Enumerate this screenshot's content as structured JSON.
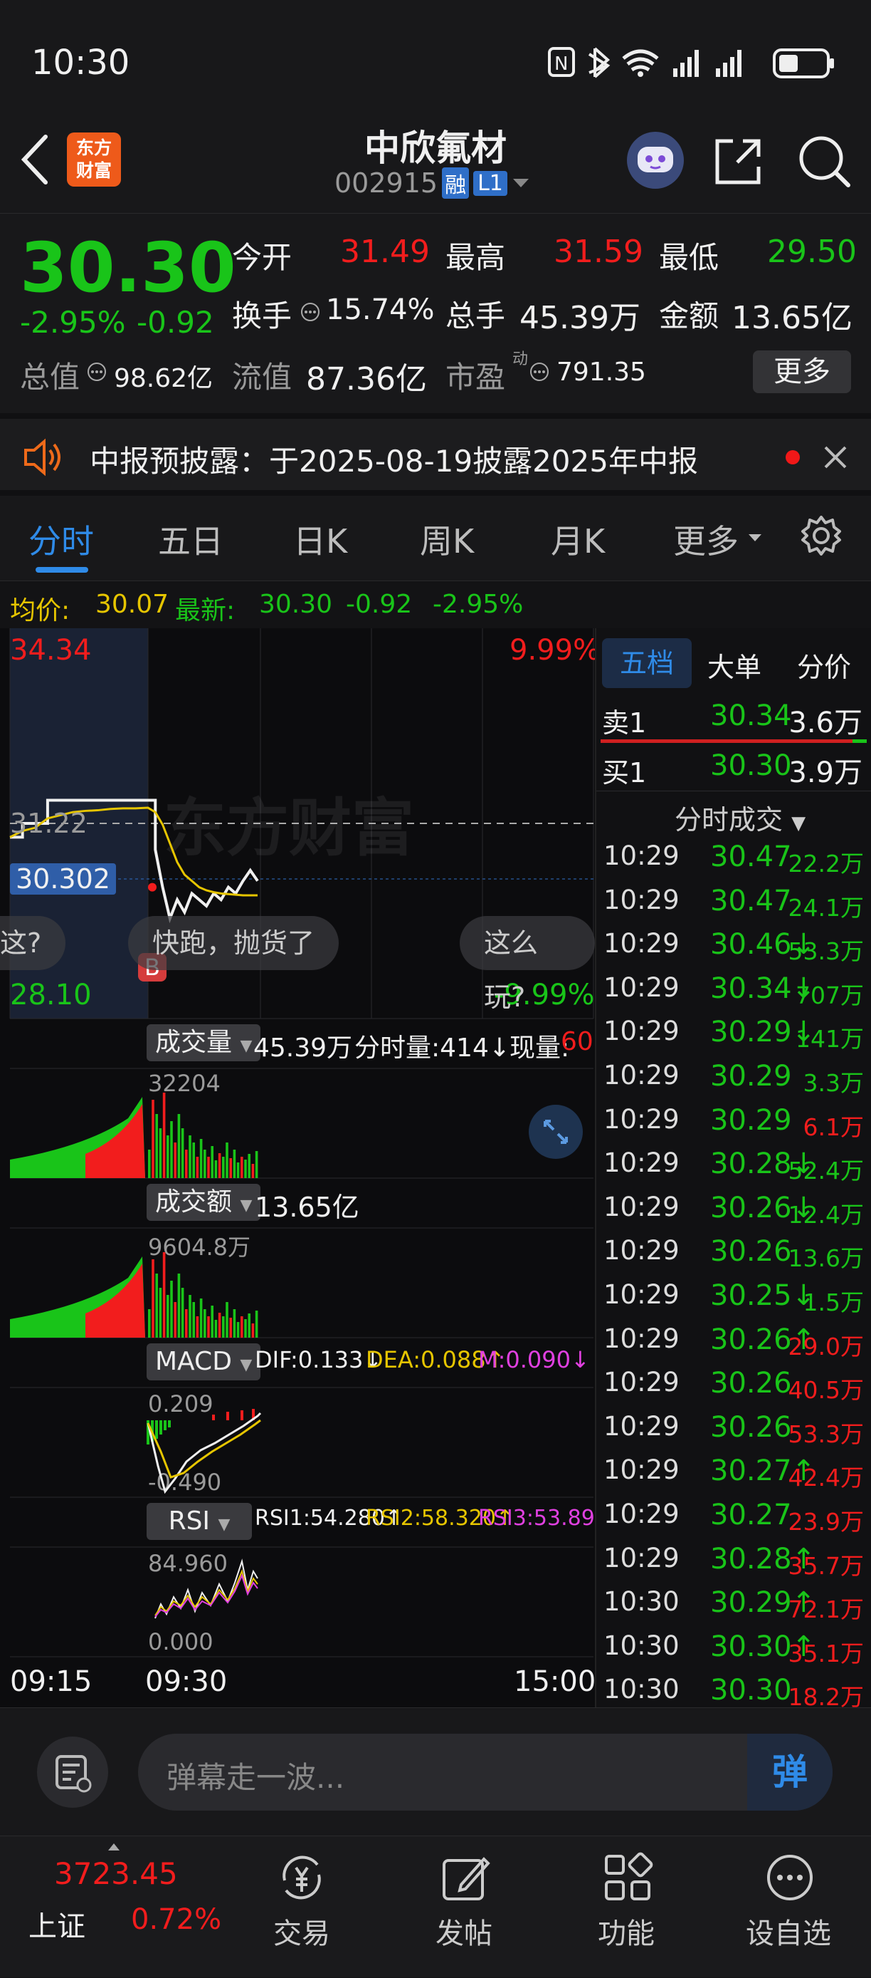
{
  "status": {
    "time": "10:30"
  },
  "header": {
    "title": "中欣氟材",
    "code": "002915",
    "badge_rong": "融",
    "badge_level": "L1",
    "logo_line1": "东方",
    "logo_line2": "财富"
  },
  "quote": {
    "price": "30.30",
    "change_pct": "-2.95%",
    "change": "-0.92",
    "open_label": "今开",
    "open": "31.49",
    "high_label": "最高",
    "high": "31.59",
    "low_label": "最低",
    "low": "29.50",
    "turnover_label": "换手",
    "turnover": "15.74%",
    "volume_label": "总手",
    "volume": "45.39万",
    "amount_label": "金额",
    "amount": "13.65亿",
    "mcap_label": "总值",
    "mcap": "98.62亿",
    "float_label": "流值",
    "float": "87.36亿",
    "pe_label": "市盈",
    "pe_sup": "动",
    "pe": "791.35",
    "more_button": "更多"
  },
  "notice": {
    "text": "中报预披露：于2025-08-19披露2025年中报"
  },
  "tabs": [
    {
      "label": "分时"
    },
    {
      "label": "五日"
    },
    {
      "label": "日K"
    },
    {
      "label": "周K"
    },
    {
      "label": "月K"
    },
    {
      "label": "更多"
    }
  ],
  "infobar": {
    "avg_label": "均价:",
    "avg": "30.07",
    "latest_label": "最新:",
    "latest": "30.30",
    "change": "-0.92",
    "change_pct": "-2.95%"
  },
  "chart": {
    "top_price": "34.34",
    "top_pct": "9.99%",
    "bottom_price": "28.10",
    "bottom_pct": "-9.99%",
    "ref_price": "31.22",
    "cursor_price": "30.302",
    "watermark": "东方财富",
    "b_marker": "B",
    "danmaku": [
      "这?",
      "快跑，抛货了",
      "这么玩?"
    ],
    "volume": {
      "label": "成交量",
      "total": "45.39万",
      "period_label": "分时量:414↓",
      "now_label": "现量:",
      "now": "60",
      "max": "32204"
    },
    "amount": {
      "label": "成交额",
      "total": "13.65亿",
      "max": "9604.8万"
    },
    "macd": {
      "label": "MACD",
      "dif": "DIF:0.133↓",
      "dea": "DEA:0.088↑",
      "m": "M:0.090↓",
      "top": "0.209",
      "bottom": "-0.490"
    },
    "rsi": {
      "label": "RSI",
      "rsi1": "RSI1:54.280↑",
      "rsi2": "RSI2:58.320↑",
      "rsi3": "RSI3:53.890↑",
      "top": "84.960",
      "bottom": "0.000"
    },
    "time_axis": [
      "09:15",
      "09:30",
      "15:00"
    ]
  },
  "chart_data": {
    "type": "line",
    "title": "",
    "ylim": [
      28.1,
      34.34
    ],
    "reference": 31.22,
    "series": [
      {
        "name": "",
        "values": [
          31.0,
          31.22,
          31.22,
          31.59,
          31.59,
          31.59,
          31.59,
          31.59,
          31.59,
          31.59,
          31.59,
          31.59,
          30.8,
          30.2,
          29.7,
          30.0,
          29.8,
          30.1,
          30.0,
          29.9,
          30.1,
          30.0,
          30.2,
          30.1,
          30.3,
          30.47,
          30.3
        ]
      },
      {
        "name": "",
        "values": [
          31.0,
          31.1,
          31.15,
          31.3,
          31.35,
          31.4,
          31.42,
          31.43,
          31.45,
          31.46,
          31.46,
          31.47,
          31.4,
          31.2,
          30.9,
          30.6,
          30.4,
          30.3,
          30.2,
          30.15,
          30.12,
          30.1,
          30.09,
          30.08,
          30.07,
          30.07,
          30.07
        ]
      }
    ]
  },
  "rightpanel": {
    "tabs": [
      "五档",
      "大单",
      "分价"
    ],
    "sell1_label": "卖1",
    "sell1_price": "30.34",
    "sell1_vol": "3.6万",
    "buy1_label": "买1",
    "buy1_price": "30.30",
    "buy1_vol": "3.9万",
    "trades_title": "分时成交",
    "trades": [
      {
        "t": "10:29",
        "p": "30.47",
        "v": "22.2万",
        "pc": "g",
        "vc": "g"
      },
      {
        "t": "10:29",
        "p": "30.47",
        "v": "24.1万",
        "pc": "g",
        "vc": "g"
      },
      {
        "t": "10:29",
        "p": "30.46↓",
        "v": "53.3万",
        "pc": "g",
        "vc": "g"
      },
      {
        "t": "10:29",
        "p": "30.34↓",
        "v": "707万",
        "pc": "g",
        "vc": "g"
      },
      {
        "t": "10:29",
        "p": "30.29↓",
        "v": "141万",
        "pc": "g",
        "vc": "g"
      },
      {
        "t": "10:29",
        "p": "30.29",
        "v": "3.3万",
        "pc": "g",
        "vc": "g"
      },
      {
        "t": "10:29",
        "p": "30.29",
        "v": "6.1万",
        "pc": "g",
        "vc": "r"
      },
      {
        "t": "10:29",
        "p": "30.28↓",
        "v": "52.4万",
        "pc": "g",
        "vc": "g"
      },
      {
        "t": "10:29",
        "p": "30.26↓",
        "v": "12.4万",
        "pc": "g",
        "vc": "g"
      },
      {
        "t": "10:29",
        "p": "30.26",
        "v": "13.6万",
        "pc": "g",
        "vc": "g"
      },
      {
        "t": "10:29",
        "p": "30.25↓",
        "v": "1.5万",
        "pc": "g",
        "vc": "g"
      },
      {
        "t": "10:29",
        "p": "30.26↑",
        "v": "29.0万",
        "pc": "g",
        "vc": "r"
      },
      {
        "t": "10:29",
        "p": "30.26",
        "v": "40.5万",
        "pc": "g",
        "vc": "r"
      },
      {
        "t": "10:29",
        "p": "30.26",
        "v": "53.3万",
        "pc": "g",
        "vc": "r"
      },
      {
        "t": "10:29",
        "p": "30.27↑",
        "v": "42.4万",
        "pc": "g",
        "vc": "r"
      },
      {
        "t": "10:29",
        "p": "30.27",
        "v": "23.9万",
        "pc": "g",
        "vc": "r"
      },
      {
        "t": "10:29",
        "p": "30.28↑",
        "v": "35.7万",
        "pc": "g",
        "vc": "r"
      },
      {
        "t": "10:30",
        "p": "30.29↑",
        "v": "72.1万",
        "pc": "g",
        "vc": "r"
      },
      {
        "t": "10:30",
        "p": "30.30↑",
        "v": "35.1万",
        "pc": "g",
        "vc": "r"
      },
      {
        "t": "10:30",
        "p": "30.30",
        "v": "18.2万",
        "pc": "g",
        "vc": "r"
      }
    ]
  },
  "input": {
    "placeholder": "弹幕走一波...",
    "send": "弹"
  },
  "nav": {
    "index_value": "3723.45",
    "index_name": "上证",
    "index_pct": "0.72%",
    "items": [
      "交易",
      "发帖",
      "功能",
      "设自选"
    ]
  }
}
